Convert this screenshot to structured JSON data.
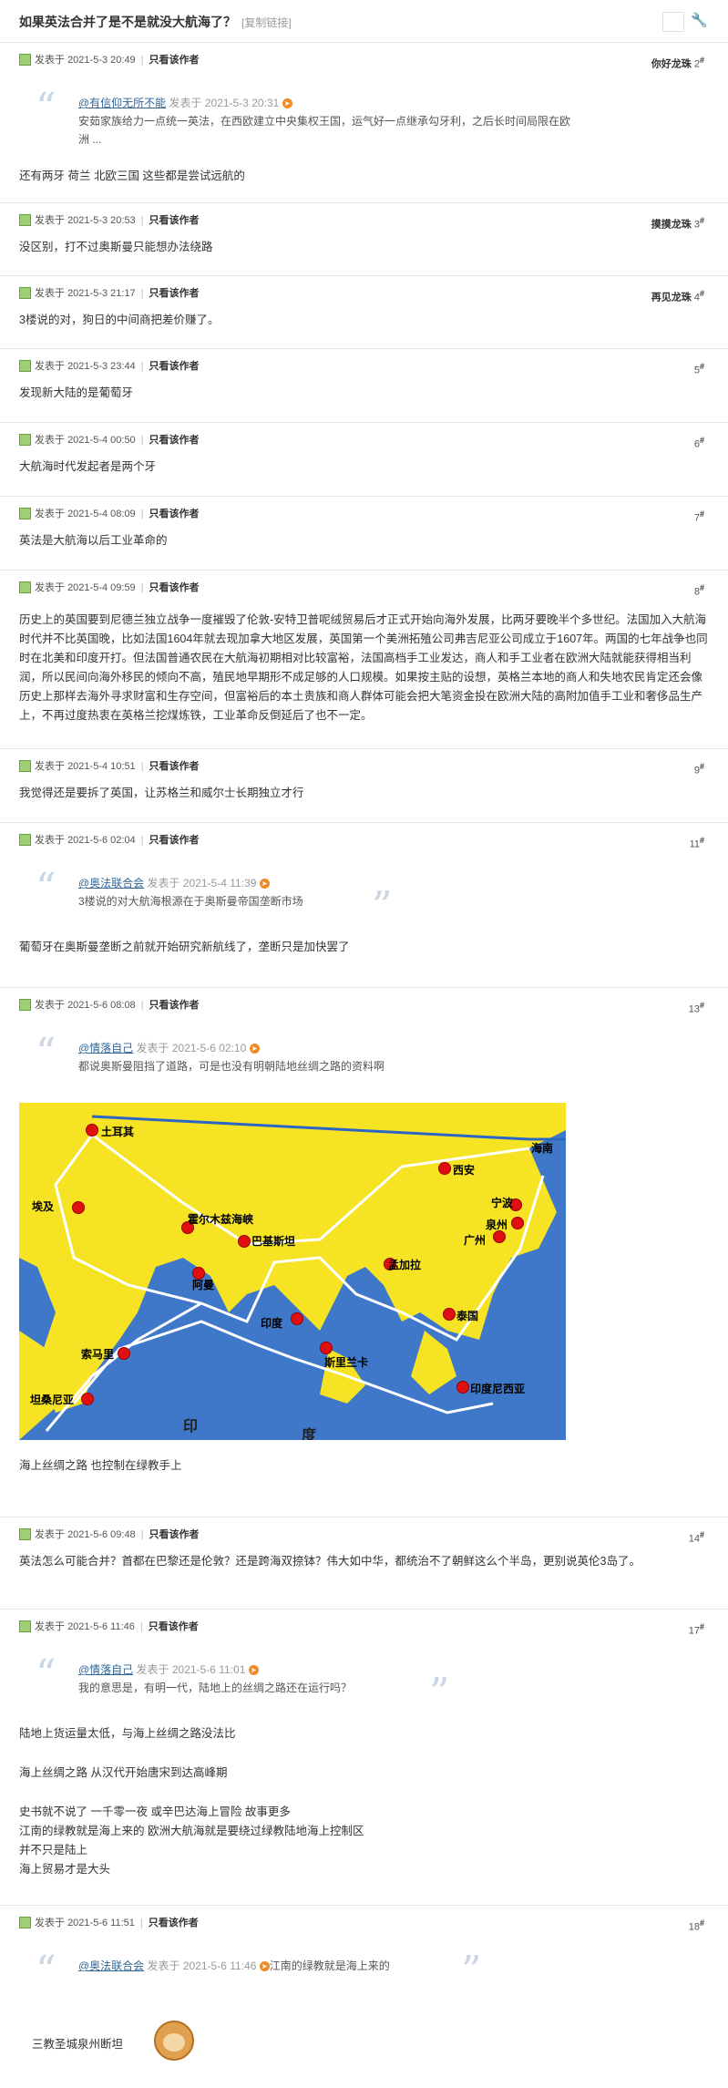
{
  "header": {
    "title": "如果英法合并了是不是就没大航海了？",
    "copy_link": "[复制链接]",
    "wrench_icon": "wrench-icon"
  },
  "common": {
    "posted_prefix": "发表于",
    "only_author": "只看该作者",
    "floor_suffix": "#"
  },
  "posts": [
    {
      "date": "2021-5-3 20:49",
      "user": "你好龙珠",
      "floor": "2",
      "quote": {
        "user": "@有信仰无所不能",
        "date": "发表于 2021-5-3 20:31",
        "text": "安茹家族给力一点统一英法，在西欧建立中央集权王国，运气好一点继承勾牙利，之后长时间局限在欧洲  ..."
      },
      "lines": [
        "还有两牙 荷兰 北欧三国  这些都是尝试远航的"
      ]
    },
    {
      "date": "2021-5-3 20:53",
      "user": "摸摸龙珠",
      "floor": "3",
      "lines": [
        "没区别，打不过奥斯曼只能想办法绕路"
      ]
    },
    {
      "date": "2021-5-3 21:17",
      "user": "再见龙珠",
      "floor": "4",
      "lines": [
        "3楼说的对，狗日的中间商把差价赚了。"
      ]
    },
    {
      "date": "2021-5-3 23:44",
      "user": "",
      "floor": "5",
      "lines": [
        "发现新大陆的是葡萄牙"
      ]
    },
    {
      "date": "2021-5-4 00:50",
      "user": "",
      "floor": "6",
      "lines": [
        "大航海时代发起者是两个牙"
      ]
    },
    {
      "date": "2021-5-4 08:09",
      "user": "",
      "floor": "7",
      "lines": [
        "英法是大航海以后工业革命的"
      ]
    },
    {
      "date": "2021-5-4 09:59",
      "user": "",
      "floor": "8",
      "lines": [
        "历史上的英国要到尼德兰独立战争一度摧毁了伦敦-安特卫普呢绒贸易后才正式开始向海外发展，比两牙要晚半个多世纪。法国加入大航海时代并不比英国晚，比如法国1604年就去现加拿大地区发展，英国第一个美洲拓殖公司弗吉尼亚公司成立于1607年。两国的七年战争也同时在北美和印度开打。但法国普通农民在大航海初期相对比较富裕，法国高档手工业发达，商人和手工业者在欧洲大陆就能获得相当利润，所以民间向海外移民的倾向不高，殖民地早期形不成足够的人口规模。如果按主贴的设想，英格兰本地的商人和失地农民肯定还会像历史上那样去海外寻求财富和生存空间，但富裕后的本土贵族和商人群体可能会把大笔资金投在欧洲大陆的高附加值手工业和奢侈品生产上，不再过度热衷在英格兰挖煤炼铁，工业革命反倒延后了也不一定。"
      ]
    },
    {
      "date": "2021-5-4 10:51",
      "user": "",
      "floor": "9",
      "lines": [
        "我觉得还是要拆了英国，让苏格兰和威尔士长期独立才行"
      ]
    },
    {
      "date": "2021-5-6 02:04",
      "user": "",
      "floor": "11",
      "quote": {
        "user": "@奥法联合会",
        "date": "发表于 2021-5-4 11:39",
        "text": "3楼说的对大航海根源在于奥斯曼帝国垄断市场"
      },
      "lines": [
        "葡萄牙在奥斯曼垄断之前就开始研究新航线了，垄断只是加快罢了"
      ]
    },
    {
      "date": "2021-5-6 08:08",
      "user": "",
      "floor": "13",
      "quote": {
        "user": "@情落自己",
        "date": "发表于 2021-5-6 02:10",
        "text": "都说奥斯曼阻挡了道路，可是也没有明朝陆地丝绸之路的资料啊"
      },
      "map": {
        "labels": [
          "土耳其",
          "埃及",
          "霍尔木兹海峡",
          "巴基斯坦",
          "阿曼",
          "印度",
          "孟加拉",
          "索马里",
          "斯里兰卡",
          "坦桑尼亚",
          "西安",
          "泉州",
          "宁波",
          "广州",
          "泰国",
          "印度尼西亚",
          "海南",
          "印",
          "度"
        ]
      },
      "lines": [
        "海上丝绸之路 也控制在绿教手上"
      ]
    },
    {
      "date": "2021-5-6 09:48",
      "user": "",
      "floor": "14",
      "lines": [
        "英法怎么可能合并？首都在巴黎还是伦敦？还是跨海双捺钵？伟大如中华，都统治不了朝鲜这么个半岛，更别说英伦3岛了。"
      ]
    },
    {
      "date": "2021-5-6 11:46",
      "user": "",
      "floor": "17",
      "quote": {
        "user": "@情落自己",
        "date": "发表于 2021-5-6 11:01",
        "text": "我的意思是，有明一代，陆地上的丝绸之路还在运行吗？"
      },
      "lines": [
        "陆地上货运量太低，与海上丝绸之路没法比",
        "",
        "海上丝绸之路 从汉代开始唐宋到达高峰期",
        "",
        "史书就不说了 一千零一夜 或辛巴达海上冒险 故事更多",
        "江南的绿教就是海上来的 欧洲大航海就是要绕过绿教陆地海上控制区",
        "并不只是陆上",
        "海上贸易才是大头"
      ]
    },
    {
      "date": "2021-5-6 11:51",
      "user": "",
      "floor": "18",
      "quote": {
        "user": "@奥法联合会",
        "date": "发表于 2021-5-6 11:46",
        "text": "江南的绿教就是海上来的"
      },
      "lines": [
        "三教圣城泉州断坦"
      ]
    }
  ]
}
